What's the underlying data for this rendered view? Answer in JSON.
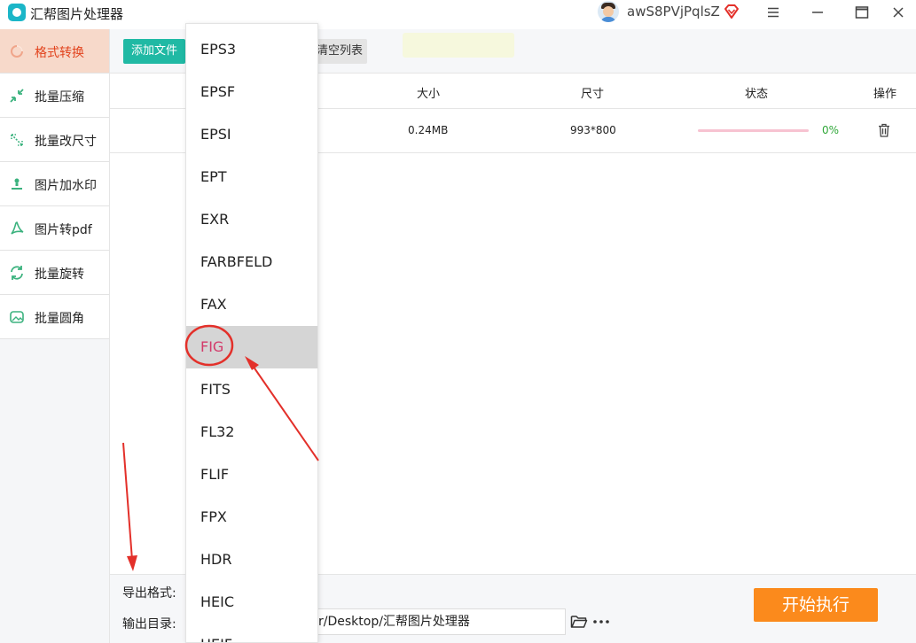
{
  "app": {
    "title": "汇帮图片处理器"
  },
  "user": {
    "name": "awS8PVjPqlsZ"
  },
  "colors": {
    "accent": "#20b9a4",
    "sidebar_active": "#f7d9ca",
    "active_text": "#e2431d",
    "start_button": "#fb8a1c",
    "progress": "#e14e7c",
    "selected_item": "#d33a6a",
    "annotation": "#e3302a"
  },
  "sidebar": {
    "items": [
      {
        "label": "格式转换",
        "icon": "format-convert-icon",
        "active": true
      },
      {
        "label": "批量压缩",
        "icon": "compress-icon",
        "active": false
      },
      {
        "label": "批量改尺寸",
        "icon": "resize-icon",
        "active": false
      },
      {
        "label": "图片加水印",
        "icon": "watermark-icon",
        "active": false
      },
      {
        "label": "图片转pdf",
        "icon": "pdf-icon",
        "active": false
      },
      {
        "label": "批量旋转",
        "icon": "rotate-icon",
        "active": false
      },
      {
        "label": "批量圆角",
        "icon": "rounded-corner-icon",
        "active": false
      }
    ]
  },
  "toolbar": {
    "add_label": "添加文件",
    "clear_label": "清空列表"
  },
  "table": {
    "columns": [
      "大小",
      "尺寸",
      "状态",
      "操作"
    ],
    "rows": [
      {
        "size": "0.24MB",
        "dimensions": "993*800",
        "progress_percent": 0,
        "progress_text": "0%"
      }
    ]
  },
  "bottom": {
    "format_label": "导出格式:",
    "dir_label": "输出目录:",
    "dir_value": "r/Desktop/汇帮图片处理器",
    "start_label": "开始执行"
  },
  "dropdown": {
    "items": [
      "EPS3",
      "EPSF",
      "EPSI",
      "EPT",
      "EXR",
      "FARBFELD",
      "FAX",
      "FIG",
      "FITS",
      "FL32",
      "FLIF",
      "FPX",
      "HDR",
      "HEIC",
      "HEIF"
    ],
    "selected": "FIG"
  }
}
